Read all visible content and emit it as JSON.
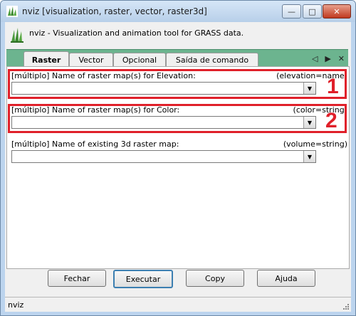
{
  "window": {
    "title": "nviz [visualization, raster, vector, raster3d]",
    "controls": {
      "minimize": "—",
      "maximize": "□",
      "close": "✕"
    }
  },
  "header": {
    "description": "nviz - Visualization and animation tool for GRASS data."
  },
  "tabs": [
    {
      "label": "Raster",
      "active": true
    },
    {
      "label": "Vector",
      "active": false
    },
    {
      "label": "Opcional",
      "active": false
    },
    {
      "label": "Saída de comando",
      "active": false
    }
  ],
  "tab_nav": {
    "prev": "◁",
    "play": "▶",
    "close": "✕"
  },
  "fields": [
    {
      "label": "[múltiplo] Name of raster map(s) for Elevation:",
      "key": "(elevation=name)",
      "value": ""
    },
    {
      "label": "[múltiplo] Name of raster map(s) for Color:",
      "key": "(color=string)",
      "value": ""
    },
    {
      "label": "[múltiplo] Name of existing 3d raster map:",
      "key": "(volume=string)",
      "value": ""
    }
  ],
  "annotations": [
    "1",
    "2"
  ],
  "buttons": {
    "close": "Fechar",
    "run": "Executar",
    "copy": "Copy",
    "help": "Ajuda"
  },
  "status": {
    "text": "nviz"
  },
  "colors": {
    "tab_strip": "#6cb48f",
    "highlight": "#e0202a",
    "titlebar": "#bcd4ee"
  },
  "icons": [
    "grass-app-icon",
    "grass-logo-icon",
    "chevron-down-icon",
    "resize-grip-icon"
  ]
}
